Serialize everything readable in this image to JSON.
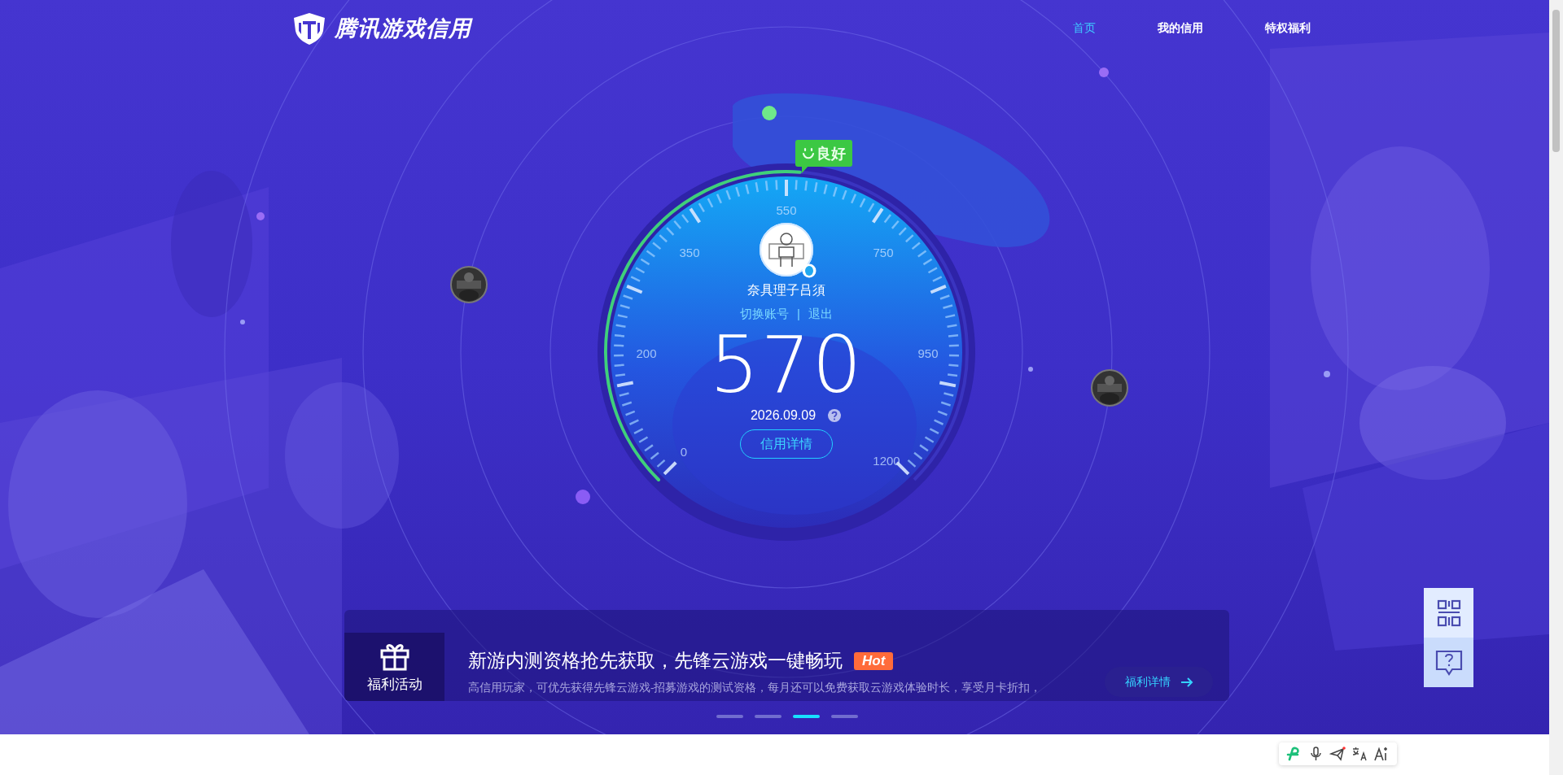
{
  "logo": {
    "text": "腾讯游戏信用"
  },
  "nav": [
    {
      "label": "首页",
      "selected": true
    },
    {
      "label": "我的信用",
      "selected": false
    },
    {
      "label": "特权福利",
      "selected": false
    }
  ],
  "credit": {
    "badge": "良好",
    "scale_labels": [
      "0",
      "200",
      "350",
      "550",
      "750",
      "950",
      "1200"
    ],
    "level": 0.516,
    "user_name": "奈具理子吕須",
    "switch_account": "切换账号",
    "separator": "|",
    "logout": "退出",
    "score": "570",
    "date": "2026.09.09",
    "details_button": "信用详情"
  },
  "banner": {
    "category": "福利活动",
    "title": "新游内测资格抢先获取，先锋云游戏一键畅玩",
    "tag": "Hot",
    "description": "高信用玩家，可优先获得先锋云游戏-招募游戏的测试资格，每月还可以免费获取云游戏体验时长，享受月卡折扣，",
    "button": "福利详情"
  },
  "carousel": [
    {
      "selected": false
    },
    {
      "selected": false
    },
    {
      "selected": true
    },
    {
      "selected": false
    }
  ]
}
